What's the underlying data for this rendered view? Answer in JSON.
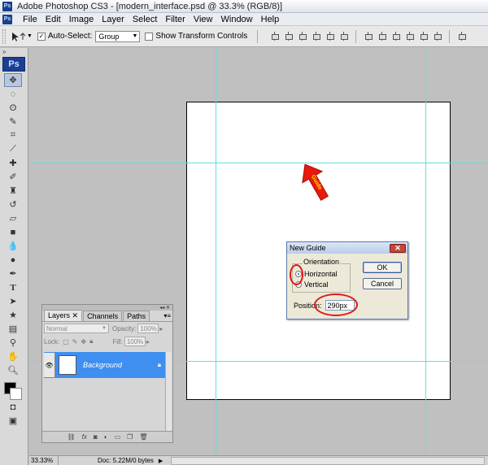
{
  "window": {
    "title": "Adobe Photoshop CS3 - [modern_interface.psd @ 33.3% (RGB/8)]",
    "app_icon": "Ps"
  },
  "menu": {
    "items": [
      "File",
      "Edit",
      "Image",
      "Layer",
      "Select",
      "Filter",
      "View",
      "Window",
      "Help"
    ]
  },
  "options": {
    "auto_select_label": "Auto-Select:",
    "auto_select_value": "Group",
    "show_transform_label": "Show Transform Controls"
  },
  "tools": {
    "logo": "Ps"
  },
  "dialog": {
    "title": "New Guide",
    "orientation_label": "Orientation",
    "horizontal_label": "Horizontal",
    "vertical_label": "Vertical",
    "position_label": "Position:",
    "position_value": "290px",
    "ok_label": "OK",
    "cancel_label": "Cancel",
    "selected_orientation": "Horizontal"
  },
  "annotation": {
    "arrow_text": "Guide",
    "arrow_color": "#e8180c",
    "circle_color": "#e0181b"
  },
  "layers_panel": {
    "tabs": [
      "Layers",
      "Channels",
      "Paths"
    ],
    "blend_mode": "Normal",
    "opacity_label": "Opacity:",
    "opacity_value": "100%",
    "lock_label": "Lock:",
    "fill_label": "Fill:",
    "fill_value": "100%",
    "layer_name": "Background",
    "layer_highlight": "#3e8ff0"
  },
  "status": {
    "zoom": "33.33%",
    "doc_info": "Doc: 5.22M/0 bytes"
  },
  "colors": {
    "guide": "#5fe0e0",
    "workspace_bg": "#c0c0c0"
  }
}
